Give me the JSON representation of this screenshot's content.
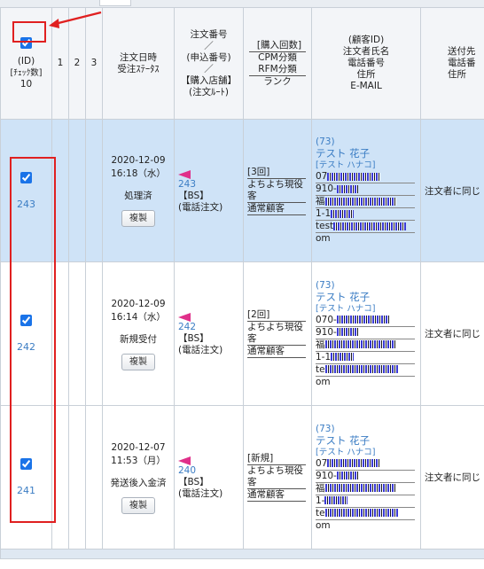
{
  "header": {
    "id_line1": "(ID)",
    "id_line2": "[ﾁｪｯｸ数]",
    "id_count": "10",
    "col1": "1",
    "col2": "2",
    "col3": "3",
    "date_status": "注文日時\n受注ｽﾃｰﾀｽ",
    "order_no": "注文番号\n／\n(申込番号)\n／\n【購入店舗】\n(注文ﾙｰﾄ)",
    "purchase_count": "[購入回数]",
    "cpm_rfm": "CPM分類\nRFM分類",
    "rank": "ランク",
    "customer": "(顧客ID)\n注文者氏名\n電話番号\n住所\nE-MAIL",
    "dest": "送付先\n電話番\n住所"
  },
  "rows": [
    {
      "id": "243",
      "checked": true,
      "selected": true,
      "date": "2020-12-09",
      "time": "16:18（水）",
      "status": "処理済",
      "copy": "複製",
      "order_no": "243",
      "shop": "【BS】",
      "route": "(電話注文)",
      "count": "[3回]",
      "cpm": "よちよち現役客",
      "rfm": "通常顧客",
      "cust_id": "(73)",
      "name": "テスト 花子",
      "kana": "[テスト ハナコ]",
      "phone": "07",
      "zip": "910-",
      "addr1": "福",
      "addr2": "1-1",
      "email": "test",
      "email2": "om",
      "dest": "注文者に同じ"
    },
    {
      "id": "242",
      "checked": true,
      "selected": false,
      "date": "2020-12-09",
      "time": "16:14（水）",
      "status": "新規受付",
      "copy": "複製",
      "order_no": "242",
      "shop": "【BS】",
      "route": "(電話注文)",
      "count": "[2回]",
      "cpm": "よちよち現役客",
      "rfm": "通常顧客",
      "cust_id": "(73)",
      "name": "テスト 花子",
      "kana": "[テスト ハナコ]",
      "phone": "070-",
      "zip": "910-",
      "addr1": "福",
      "addr2": "1-1",
      "email": "te",
      "email2": "om",
      "dest": "注文者に同じ"
    },
    {
      "id": "241",
      "checked": true,
      "selected": false,
      "date": "2020-12-07",
      "time": "11:53（月）",
      "status": "発送後入金済",
      "copy": "複製",
      "order_no": "240",
      "shop": "【BS】",
      "route": "(電話注文)",
      "count": "[新規]",
      "cpm": "よちよち現役客",
      "rfm": "通常顧客",
      "cust_id": "(73)",
      "name": "テスト 花子",
      "kana": "[テスト ハナコ]",
      "phone": "07",
      "zip": "910-",
      "addr1": "福",
      "addr2": "1-",
      "email": "te",
      "email2": "om",
      "dest": "注文者に同じ"
    }
  ],
  "colors": {
    "selected_row": "#cfe3f7",
    "link": "#3b7dc4",
    "annotation": "#e02020",
    "flag": "#e0308a"
  }
}
